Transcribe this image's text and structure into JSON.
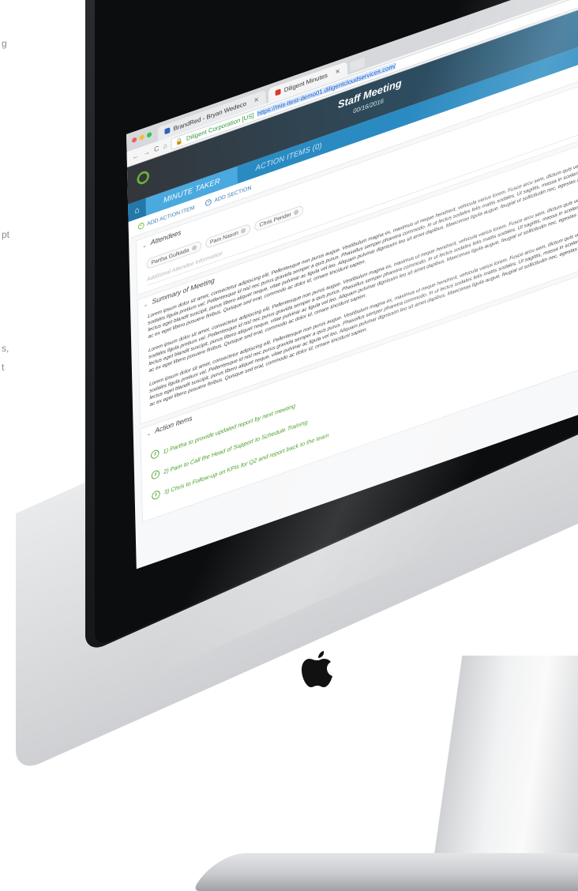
{
  "stray_text": [
    "g",
    "pt",
    "s,",
    "t"
  ],
  "browser": {
    "tabs": [
      {
        "label": "BrandRed - Bryan Wedeco",
        "active": false
      },
      {
        "label": "Diligent Minutes",
        "active": true
      }
    ],
    "org": "Diligent Corporation [US]",
    "url": "https://mis-itest-demo01.diligentcloudservices.com/"
  },
  "app": {
    "meeting_title": "Staff Meeting",
    "meeting_date": "00/16/2016",
    "nav_tabs": [
      "MINUTE TAKER",
      "ACTION ITEMS (0)"
    ],
    "toolbar": {
      "add_action": "ADD ACTION ITEM",
      "add_section": "ADD SECTION"
    }
  },
  "attendees": {
    "heading": "Attendees",
    "people": [
      "Partha Gulkada",
      "Pam Nason",
      "Chris Pender"
    ],
    "info_placeholder": "Additional Attendee Information"
  },
  "summary": {
    "heading": "Summary of Meeting",
    "paragraphs": [
      "Lorem ipsum dolor sit amet, consectetur adipiscing elit. Pellentesque non purus augue. Vestibulum magna ex, maximus ut neque hendrerit, vehicula varius lorem. Fusce arcu sem, dictum quis vehicula sed, auctor ut ipsum. Morbi a susc sodales ligula pretium vel. Pellentesque id nisl nec purus gravida semper a quis purus. Phasellus semper pharetra commodo. In ut lectus sodales felis mattis sodales. Ut sagittis, massa in scelerisque ultrices, ante odio condimentum te lectus eget blandit suscipit, purus libero aliquet neque, vitae pulvinar ac ligula vel leo. Aliquam pulvinar dignissim leo sit amet dapibus. Maecenas ligula augue, feugiat ut sollicitudin nec, egestas a neque. Vivamus mauris mauris, ullamc ac ex eget libero posuere finibus. Quisque sed erat, commodo ac dolor id, ornare tincidunt sapien.",
      "Lorem ipsum dolor sit amet, consectetur adipiscing elit. Pellentesque non purus augue. Vestibulum magna ex, maximus ut neque hendrerit, vehicula varius lorem. Fusce arcu sem, dictum quis vehicula sed, auctor ut ipsum. Morbi a susc sodales ligula pretium vel. Pellentesque id nisl nec purus gravida semper a quis purus. Phasellus semper pharetra commodo. In ut lectus sodales felis mattis sodales. Ut sagittis, massa in scelerisque ultrices, ante odio condimentum te lectus eget blandit suscipit, purus libero aliquet neque, vitae pulvinar ac ligula vel leo. Aliquam pulvinar dignissim leo sit amet dapibus. Maecenas ligula augue, feugiat ut sollicitudin nec, egestas a neque. Vivamus mauris mauris, ullamc ac ex eget libero posuere finibus. Quisque sed erat, commodo ac dolor id, ornare tincidunt sapien.",
      "Lorem ipsum dolor sit amet, consectetur adipiscing elit. Pellentesque non purus augue. Vestibulum magna ex, maximus ut neque hendrerit, vehicula varius lorem. Fusce arcu sem, dictum quis vehicula sed, auctor ut ipsum. Morbi a susc sodales ligula pretium vel. Pellentesque id nisl nec purus gravida semper a quis purus. Phasellus semper pharetra commodo. In ut lectus sodales felis mattis sodales. Ut sagittis, massa in scelerisque ultrices, ante odio condimentum te lectus eget blandit suscipit, purus libero aliquet neque, vitae pulvinar ac ligula vel leo. Aliquam pulvinar dignissim leo sit amet dapibus. Maecenas ligula augue, feugiat ut sollicitudin nec, egestas a neque. Vivamus mauris mauris, ullamc ac ex eget libero posuere finibus. Quisque sed erat, commodo ac dolor id, ornare tincidunt sapien."
    ]
  },
  "actions": {
    "heading": "Action Items",
    "items": [
      "1) Partha to provide updated report by next meeting",
      "2) Pam to Call the Head of Support to Schedule Training",
      "3) Chris to Follow-up on KPIs for Q2 and report back to the team"
    ]
  },
  "colors": {
    "accent_blue": "#2a8bc2",
    "accent_green": "#4aa028",
    "header_dark": "#33363a"
  }
}
